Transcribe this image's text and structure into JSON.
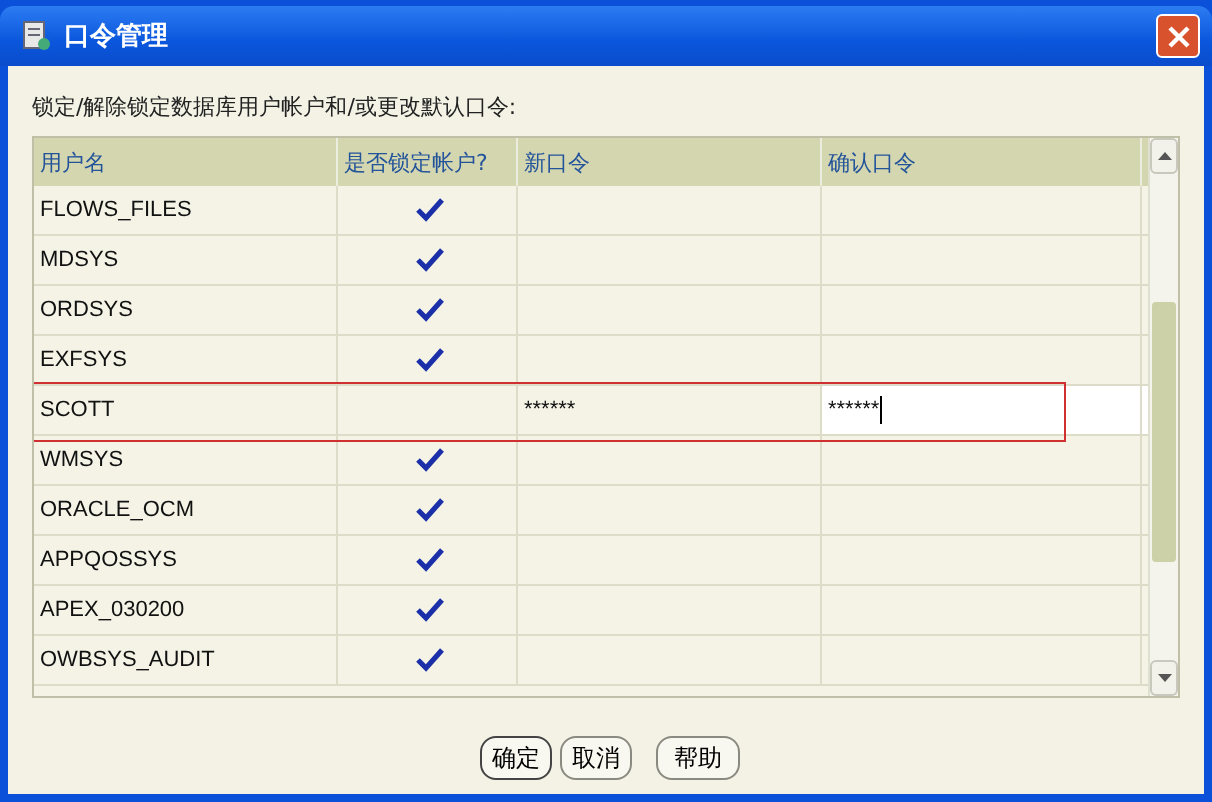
{
  "window": {
    "title": "口令管理"
  },
  "instruction": "锁定/解除锁定数据库用户帐户和/或更改默认口令:",
  "table": {
    "columns": [
      "用户名",
      "是否锁定帐户?",
      "新口令",
      "确认口令"
    ],
    "rows": [
      {
        "user": "FLOWS_FILES",
        "locked": true,
        "selected": false
      },
      {
        "user": "MDSYS",
        "locked": true,
        "selected": false
      },
      {
        "user": "ORDSYS",
        "locked": true,
        "selected": false
      },
      {
        "user": "EXFSYS",
        "locked": true,
        "selected": false
      },
      {
        "user": "SCOTT",
        "locked": false,
        "selected": true,
        "new_password": "******",
        "confirm_password": "******"
      },
      {
        "user": "WMSYS",
        "locked": true,
        "selected": false
      },
      {
        "user": "ORACLE_OCM",
        "locked": true,
        "selected": false
      },
      {
        "user": "APPQOSSYS",
        "locked": true,
        "selected": false
      },
      {
        "user": "APEX_030200",
        "locked": true,
        "selected": false
      },
      {
        "user": "OWBSYS_AUDIT",
        "locked": true,
        "selected": false
      }
    ]
  },
  "buttons": [
    "确定",
    "取消",
    "帮助"
  ]
}
